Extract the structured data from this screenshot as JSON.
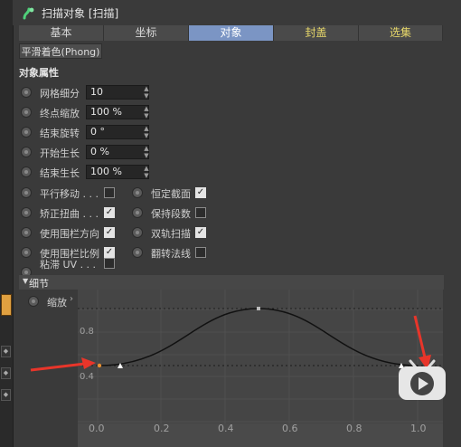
{
  "header": {
    "title": "扫描对象 [扫描]"
  },
  "tabs": [
    {
      "label": "基本"
    },
    {
      "label": "坐标"
    },
    {
      "label": "对象"
    },
    {
      "label": "封盖"
    },
    {
      "label": "选集"
    }
  ],
  "shading_button": "平滑着色(Phong)",
  "section_title": "对象属性",
  "fields": [
    {
      "label": "网格细分",
      "value": "10"
    },
    {
      "label": "终点缩放",
      "value": "100 %"
    },
    {
      "label": "结束旋转",
      "value": "0 °"
    },
    {
      "label": "开始生长",
      "value": "0 %"
    },
    {
      "label": "结束生长",
      "value": "100 %"
    }
  ],
  "checks_left": [
    {
      "label": "平行移动 . . .",
      "checked": false
    },
    {
      "label": "矫正扭曲 . . .",
      "checked": true
    },
    {
      "label": "使用围栏方向",
      "checked": true
    },
    {
      "label": "使用围栏比例",
      "checked": true
    },
    {
      "label": "粘滞 UV . . .",
      "checked": false
    }
  ],
  "checks_right": [
    {
      "label": "恒定截面",
      "checked": true
    },
    {
      "label": "保持段数",
      "checked": false
    },
    {
      "label": "双轨扫描",
      "checked": true
    },
    {
      "label": "翻转法线",
      "checked": false
    }
  ],
  "details": {
    "title": "细节",
    "zoom_label": "缩放"
  },
  "curve_graph": {
    "y_ticks": [
      "0.8",
      "0.4"
    ],
    "x_ticks": [
      "0.0",
      "0.2",
      "0.4",
      "0.6",
      "0.8",
      "1.0"
    ]
  },
  "colors": {
    "active_tab": "#7b95c4",
    "yellow_tab_text": "#e8d86a",
    "annotation_arrow": "#e8352a"
  }
}
